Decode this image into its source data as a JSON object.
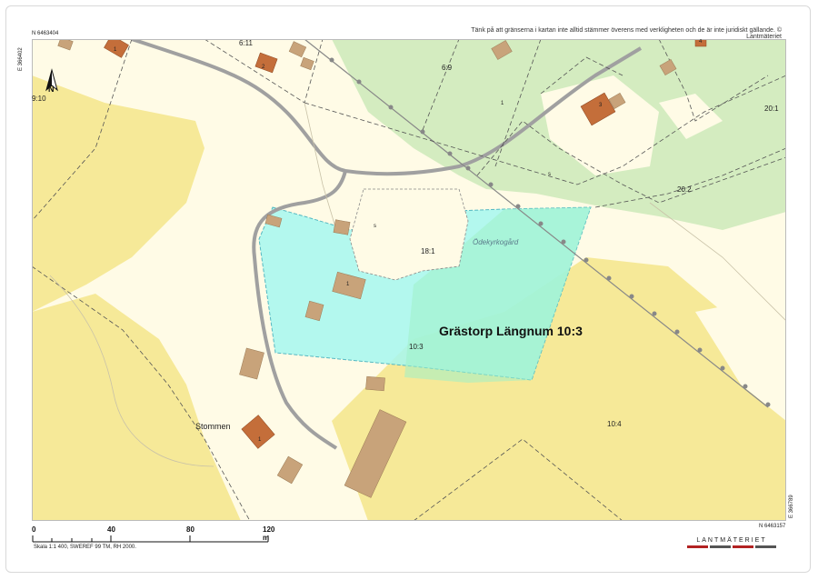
{
  "disclaimer": "Tänk på att gränserna i kartan inte alltid stämmer överens med verkligheten och de är inte juridiskt gällande. © Lantmäteriet",
  "coords": {
    "top_left_n": "N 6463404",
    "top_left_e": "E 366402",
    "bottom_right_n": "N 6463157",
    "bottom_right_e": "E 366789"
  },
  "north_label": "N",
  "property_title": "Grästorp Längnum 10:3",
  "place_names": {
    "stommen": "Stommen",
    "odekyrkogard": "Ödekyrkogård"
  },
  "parcel_labels": {
    "p_6_11": "6:11",
    "p_6_9": "6:9",
    "p_9_10": "9:10",
    "p_20_1": "20:1",
    "p_20_2": "20:2",
    "p_18_1": "18:1",
    "p_10_3": "10:3",
    "p_10_4": "10:4",
    "p_s": "s"
  },
  "house_numbers": {
    "h1_topleft": "1",
    "h2": "2",
    "h1_mid": "1",
    "h3": "3",
    "h1_pond": "1",
    "h1_stommen": "1",
    "h4_topright": "4",
    "h_small": "s"
  },
  "scale_bar": {
    "ticks": [
      "0",
      "40",
      "80",
      "120 m"
    ],
    "text": "Skala 1:1 400, SWEREF 99 TM, RH 2000."
  },
  "brand": {
    "name": "LANTMÄTERIET",
    "colors": [
      "#b22222",
      "#555555",
      "#b22222",
      "#555555"
    ]
  },
  "colors": {
    "field": "#f6e998",
    "open_land": "#fffbe6",
    "forest": "#d4ecc0",
    "property_fill": "#a6f7ef",
    "property_border": "#55b8c2",
    "building": "#c8a37a",
    "house": "#c46e3a",
    "road": "#a0a0a0"
  }
}
